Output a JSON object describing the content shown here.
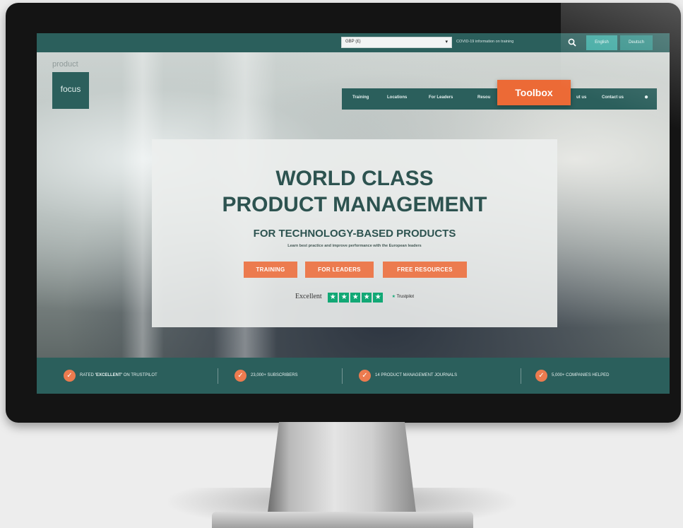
{
  "topbar": {
    "currency": "GBP (£)",
    "covid_link": "COVID-19 information on training",
    "lang_english": "English",
    "lang_deutsch": "Deutsch"
  },
  "logo": {
    "top": "product",
    "box": "focus"
  },
  "nav": {
    "items": [
      "Training",
      "Locations",
      "For Leaders",
      "Resou",
      "ut us",
      "Contact us"
    ],
    "highlight": "Toolbox"
  },
  "hero": {
    "title_line1": "WORLD CLASS",
    "title_line2": "PRODUCT MANAGEMENT",
    "subtitle": "FOR TECHNOLOGY-BASED PRODUCTS",
    "tagline": "Learn best practice and improve performance with the European leaders",
    "buttons": [
      "TRAINING",
      "FOR LEADERS",
      "FREE RESOURCES"
    ],
    "rating_label": "Excellent",
    "trustpilot": "Trustpilot"
  },
  "stats": {
    "items": [
      {
        "pre": "RATED ",
        "strong": "'EXCELLENT'",
        "post": " ON TRUSTPILOT"
      },
      {
        "pre": "23,000+ SUBSCRIBERS",
        "strong": "",
        "post": ""
      },
      {
        "pre": "14 PRODUCT MANAGEMENT JOURNALS",
        "strong": "",
        "post": ""
      },
      {
        "pre": "5,000+ COMPANIES HELPED",
        "strong": "",
        "post": ""
      }
    ]
  },
  "colors": {
    "teal": "#2b5f5c",
    "orange": "#ec6a36",
    "trustpilot_green": "#12a875"
  }
}
